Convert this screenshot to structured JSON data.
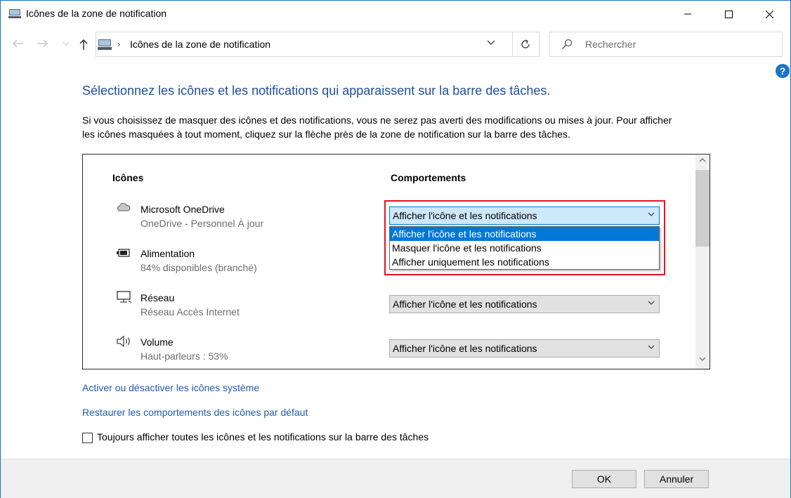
{
  "window": {
    "title": "Icônes de la zone de notification"
  },
  "address": {
    "path": "Icônes de la zone de notification"
  },
  "search": {
    "placeholder": "Rechercher"
  },
  "help_label": "?",
  "main": {
    "heading": "Sélectionnez les icônes et les notifications qui apparaissent sur la barre des tâches.",
    "description_line1": "Si vous choisissez de masquer des icônes et des notifications, vous ne serez pas averti des modifications ou mises à jour. Pour afficher",
    "description_line2": "les icônes masquées à tout moment, cliquez sur la flèche près de la zone de notification sur la barre des tâches."
  },
  "table": {
    "col_icons": "Icônes",
    "col_behaviors": "Comportements",
    "rows": [
      {
        "name": "Microsoft OneDrive",
        "sub": "OneDrive - Personnel À jour",
        "icon": "cloud-icon",
        "behavior": "Afficher l'icône et les notifications"
      },
      {
        "name": "Alimentation",
        "sub": "84% disponibles (branché)",
        "icon": "battery-icon",
        "behavior": ""
      },
      {
        "name": "Réseau",
        "sub": "Réseau Accès Internet",
        "icon": "network-icon",
        "behavior": "Afficher l'icône et les notifications"
      },
      {
        "name": "Volume",
        "sub": "Haut-parleurs : 53%",
        "icon": "speaker-icon",
        "behavior": "Afficher l'icône et les notifications"
      }
    ]
  },
  "dropdown": {
    "options": [
      "Afficher l'icône et les notifications",
      "Masquer l'icône et les notifications",
      "Afficher uniquement les notifications"
    ],
    "selected_index": 0
  },
  "links": {
    "system_icons": "Activer ou désactiver les icônes système",
    "restore": "Restaurer les comportements des icônes par défaut"
  },
  "always_show": {
    "label": "Toujours afficher toutes les icônes et les notifications sur la barre des tâches",
    "checked": false
  },
  "buttons": {
    "ok": "OK",
    "cancel": "Annuler"
  },
  "colors": {
    "accent": "#0078d7",
    "heading": "#1f4e9a",
    "link": "#1f5cab",
    "highlight_box": "#e81123"
  }
}
